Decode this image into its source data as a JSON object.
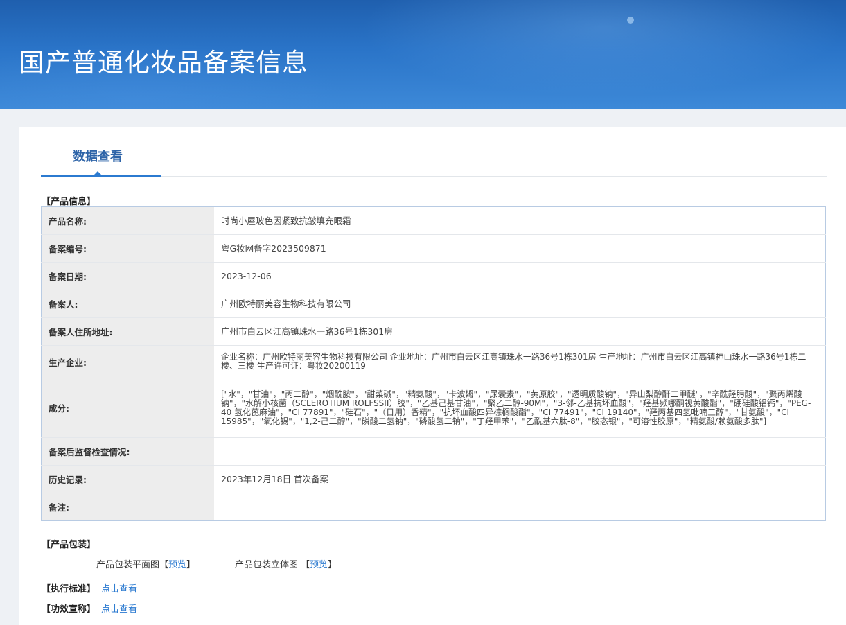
{
  "banner": {
    "title": "国产普通化妆品备案信息"
  },
  "tabs": [
    {
      "label": "数据查看",
      "active": true
    }
  ],
  "product_info": {
    "section_title": "【产品信息】",
    "rows": [
      {
        "label": "产品名称:",
        "value": "时尚小屋玻色因紧致抗皱填充眼霜"
      },
      {
        "label": "备案编号:",
        "value": "粤G妆网备字2023509871"
      },
      {
        "label": "备案日期:",
        "value": "2023-12-06"
      },
      {
        "label": "备案人:",
        "value": "广州欧特丽美容生物科技有限公司"
      },
      {
        "label": "备案人住所地址:",
        "value": "广州市白云区江高镇珠水一路36号1栋301房"
      },
      {
        "label": "生产企业:",
        "value": "企业名称：广州欧特丽美容生物科技有限公司 企业地址：广州市白云区江高镇珠水一路36号1栋301房 生产地址：广州市白云区江高镇神山珠水一路36号1栋二楼、三楼 生产许可证：粤妆20200119"
      },
      {
        "label": "成分:",
        "value": "[\"水\"，\"甘油\"，\"丙二醇\"，\"烟酰胺\"，\"甜菜碱\"，\"精氨酸\"，\"卡波姆\"，\"尿囊素\"，\"黄原胶\"，\"透明质酸钠\"，\"异山梨醇酐二甲醚\"，\"辛酰羟肟酸\"，\"聚丙烯酸钠\"，\"水解小核菌（SCLEROTIUM ROLFSSII）胶\"，\"乙基己基甘油\"，\"聚乙二醇-90M\"，\"3-邻-乙基抗坏血酸\"，\"羟基频哪酮视黄酸酯\"，\"硼硅酸铝钙\"，\"PEG-40 氢化蓖麻油\"，\"CI 77891\"，\"硅石\"，\"（日用）香精\"，\"抗坏血酸四异棕榈酸酯\"，\"CI 77491\"，\"CI 19140\"，\"羟丙基四氢吡喃三醇\"，\"甘氨酸\"，\"CI 15985\"，\"氧化锡\"，\"1,2-己二醇\"，\"磷酸二氢钠\"，\"磷酸氢二钠\"，\"丁羟甲苯\"，\"乙酰基六肽-8\"，\"胶态银\"，\"可溶性胶原\"，\"精氨酸/赖氨酸多肽\"]"
      },
      {
        "label": "备案后监督检查情况:",
        "value": ""
      },
      {
        "label": "历史记录:",
        "value": "2023年12月18日 首次备案"
      },
      {
        "label": "备注:",
        "value": ""
      }
    ]
  },
  "packaging": {
    "section_title": "【产品包装】",
    "flat_label": "产品包装平面图",
    "stereo_label": "产品包装立体图",
    "bracket_open": "【",
    "bracket_close": "】",
    "preview_label": "预览"
  },
  "standard": {
    "label": "【执行标准】",
    "link": "点击查看"
  },
  "efficacy": {
    "label": "【功效宣称】",
    "link": "点击查看"
  }
}
